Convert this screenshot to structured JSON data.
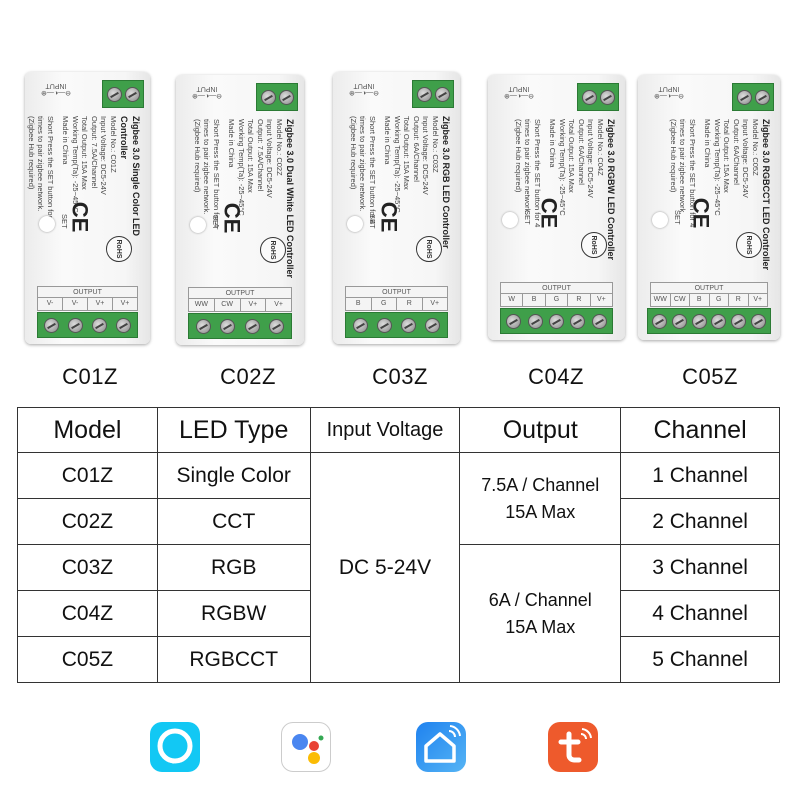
{
  "products": [
    {
      "model": "C01Z",
      "title": "Zigbee 3.0 Single Color LED Controller",
      "specs": [
        "Model No.: C01Z",
        "Input Voltage: DC5-24V",
        "Output: 7.5A/Channel",
        "Total Output: 15A Max",
        "Working Temp(Ta): -25~45°C",
        "Made in China"
      ],
      "outputs": [
        "V-",
        "V-",
        "V+",
        "V+"
      ]
    },
    {
      "model": "C02Z",
      "title": "Zigbee 3.0 Dual White LED Controller",
      "specs": [
        "Model No.: C02Z",
        "Input Voltage: DC5-24V",
        "Output: 7.5A/Channel",
        "Total Output: 15A Max",
        "Working Temp(Ta): -25~45°C",
        "Made in China"
      ],
      "outputs": [
        "WW",
        "CW",
        "V+",
        "V+"
      ]
    },
    {
      "model": "C03Z",
      "title": "Zigbee 3.0 RGB LED Controller",
      "specs": [
        "Model No.: C03Z",
        "Input Voltage: DC5-24V",
        "Output: 6A/Channel",
        "Total Output: 15A Max",
        "Working Temp(Ta): -25~45°C",
        "Made in China"
      ],
      "outputs": [
        "B",
        "G",
        "R",
        "V+"
      ]
    },
    {
      "model": "C04Z",
      "title": "Zigbee 3.0 RGBW LED Controller",
      "specs": [
        "Model No.: C04Z",
        "Input Voltage: DC5-24V",
        "Output: 6A/Channel",
        "Total Output: 15A Max",
        "Working Temp(Ta): -25~45°C",
        "Made in China"
      ],
      "outputs": [
        "W",
        "B",
        "G",
        "R",
        "V+"
      ]
    },
    {
      "model": "C05Z",
      "title": "Zigbee 3.0 RGBCCT LED Controller",
      "specs": [
        "Model No.: C05Z",
        "Input Voltage: DC5-24V",
        "Output: 6A/Channel",
        "Total Output: 15A Max",
        "Working Temp(Ta): -25~45°C",
        "Made in China"
      ],
      "outputs": [
        "WW",
        "CW",
        "B",
        "G",
        "R",
        "V+"
      ]
    }
  ],
  "device_common": {
    "instructions": [
      "Short Press the SET button for 4",
      "times to pair zigbee network.",
      "(Zigbee Hub required)"
    ],
    "input_label": "INPUT",
    "input_symbol": "⊖—◐—⊕",
    "set_label": "SET",
    "output_label": "OUTPUT",
    "vplus": "V+",
    "vminus": "V-",
    "ce": "CE",
    "rohs": "RoHS"
  },
  "table": {
    "headers": [
      "Model",
      "LED Type",
      "Input Voltage",
      "Output",
      "Channel"
    ],
    "rows": [
      {
        "model": "C01Z",
        "type": "Single Color",
        "channel": "1 Channel"
      },
      {
        "model": "C02Z",
        "type": "CCT",
        "channel": "2 Channel"
      },
      {
        "model": "C03Z",
        "type": "RGB",
        "channel": "3 Channel"
      },
      {
        "model": "C04Z",
        "type": "RGBW",
        "channel": "4 Channel"
      },
      {
        "model": "C05Z",
        "type": "RGBCCT",
        "channel": "5 Channel"
      }
    ],
    "input_voltage": "DC 5-24V",
    "output_groups": [
      [
        "7.5A / Channel",
        "15A Max"
      ],
      [
        "6A / Channel",
        "15A Max"
      ]
    ]
  },
  "apps": [
    {
      "icon": "alexa-icon",
      "color": "#12c8f4"
    },
    {
      "icon": "google-assistant-icon",
      "color": "#ffffff"
    },
    {
      "icon": "smart-life-icon",
      "color": "#2a8ef0"
    },
    {
      "icon": "tuya-icon",
      "color": "#ee5a2c"
    }
  ]
}
